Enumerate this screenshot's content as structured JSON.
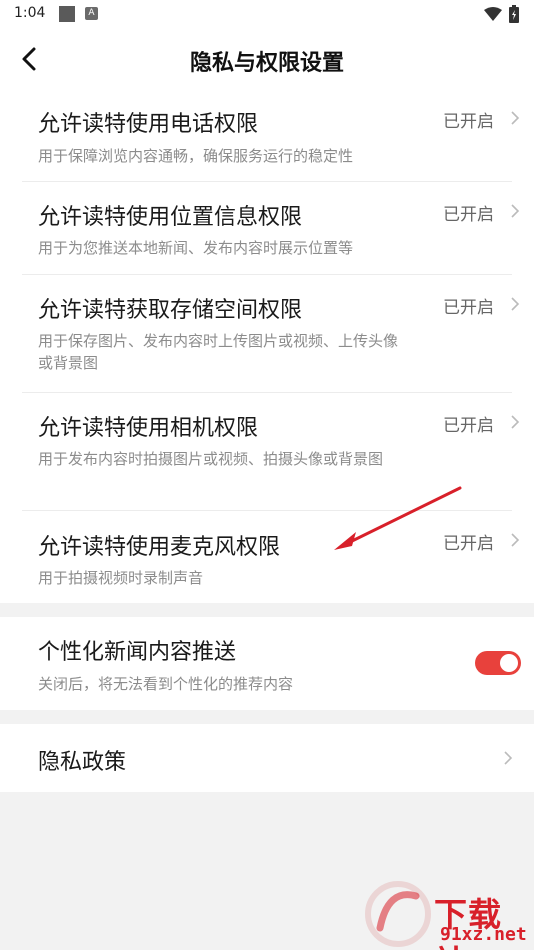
{
  "status_bar": {
    "time": "1:04",
    "notif_badge": "A"
  },
  "header": {
    "title": "隐私与权限设置"
  },
  "permissions": [
    {
      "title": "允许读特使用电话权限",
      "desc": "用于保障浏览内容通畅，确保服务运行的稳定性",
      "status": "已开启"
    },
    {
      "title": "允许读特使用位置信息权限",
      "desc": "用于为您推送本地新闻、发布内容时展示位置等",
      "status": "已开启"
    },
    {
      "title": "允许读特获取存储空间权限",
      "desc": "用于保存图片、发布内容时上传图片或视频、上传头像或背景图",
      "status": "已开启"
    },
    {
      "title": "允许读特使用相机权限",
      "desc": "用于发布内容时拍摄图片或视频、拍摄头像或背景图",
      "status": "已开启"
    },
    {
      "title": "允许读特使用麦克风权限",
      "desc": "用于拍摄视频时录制声音",
      "status": "已开启"
    }
  ],
  "personalization": {
    "title": "个性化新闻内容推送",
    "desc": "关闭后，将无法看到个性化的推荐内容",
    "enabled": true
  },
  "privacy_policy": {
    "title": "隐私政策"
  },
  "colors": {
    "accent": "#e8413c",
    "annotation_arrow": "#d8202a"
  },
  "watermark": {
    "text": "下载站",
    "url": "91xz.net"
  }
}
